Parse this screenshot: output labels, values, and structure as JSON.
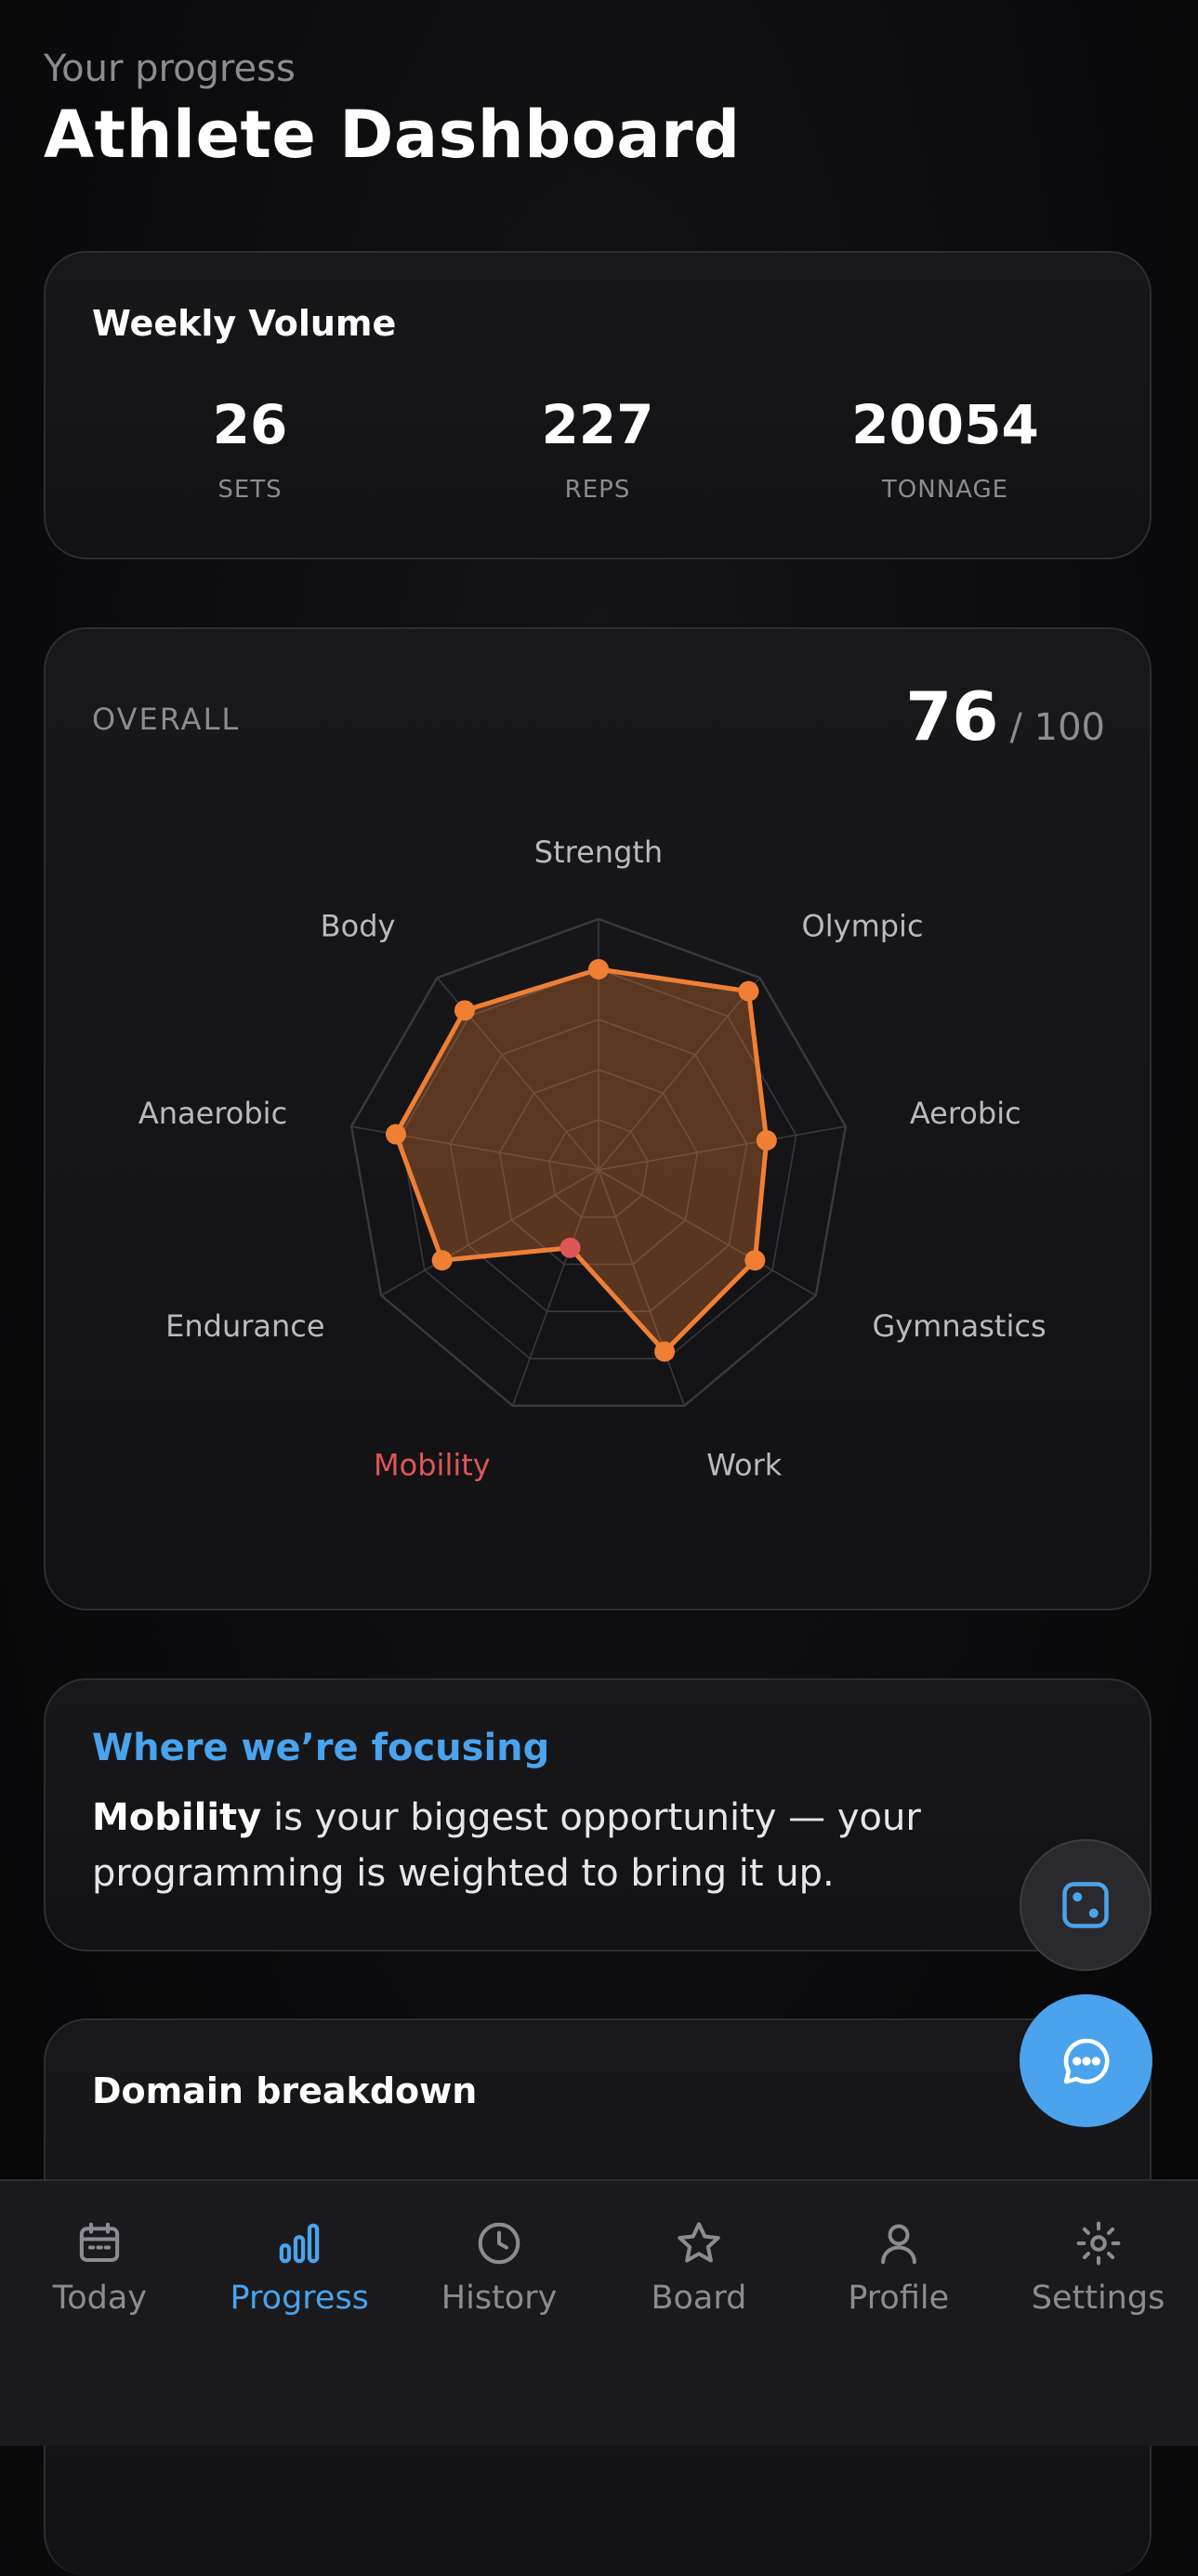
{
  "header": {
    "subtitle": "Your progress",
    "title": "Athlete Dashboard"
  },
  "weekly_volume": {
    "title": "Weekly Volume",
    "stats": [
      {
        "value": "26",
        "label": "SETS"
      },
      {
        "value": "227",
        "label": "REPS"
      },
      {
        "value": "20054",
        "label": "TONNAGE"
      }
    ]
  },
  "overall": {
    "label": "OVERALL",
    "score": "76",
    "max": "/ 100"
  },
  "chart_data": {
    "type": "radar",
    "axes": [
      "Strength",
      "Olympic",
      "Aerobic",
      "Gymnastics",
      "Work",
      "Mobility",
      "Endurance",
      "Anaerobic",
      "Body"
    ],
    "values": [
      80,
      93,
      68,
      72,
      77,
      33,
      72,
      82,
      83
    ],
    "range": [
      0,
      100
    ],
    "rings": 5,
    "highlight_axis": "Mobility",
    "colors": {
      "series": "#ee7f35",
      "fill": "rgba(238,127,53,0.32)",
      "highlight": "#e05656",
      "grid": "#38383d",
      "axis_label": "#b9b9c0"
    }
  },
  "focus": {
    "title": "Where we’re focusing",
    "highlight": "Mobility",
    "text": " is your biggest opportunity — your programming is weighted to bring it up."
  },
  "domain_breakdown": {
    "title": "Domain breakdown"
  },
  "fabs": {
    "dice_icon": "dice-icon",
    "chat_icon": "chat-icon"
  },
  "tabs": [
    {
      "label": "Today",
      "icon": "calendar-icon",
      "active": false
    },
    {
      "label": "Progress",
      "icon": "bar-chart-icon",
      "active": true
    },
    {
      "label": "History",
      "icon": "clock-icon",
      "active": false
    },
    {
      "label": "Board",
      "icon": "star-icon",
      "active": false
    },
    {
      "label": "Profile",
      "icon": "user-icon",
      "active": false
    },
    {
      "label": "Settings",
      "icon": "gear-icon",
      "active": false
    }
  ],
  "colors": {
    "accent": "#4aa3ec",
    "background": "#0b0b0d",
    "card": "#16161a",
    "muted": "#8b8b93"
  }
}
